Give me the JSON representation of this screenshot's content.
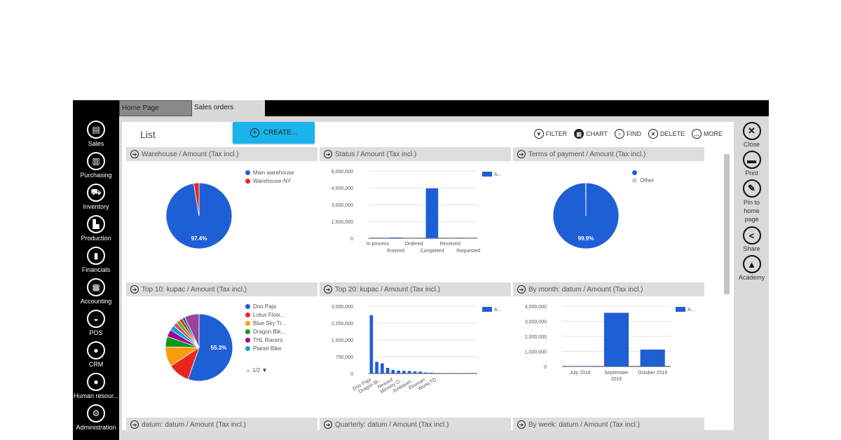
{
  "tabs": [
    {
      "label": "Home Page"
    },
    {
      "label": "Sales orders"
    }
  ],
  "sidebar": {
    "items": [
      {
        "label": "Sales",
        "icon": "sales-icon",
        "glyph": "▤"
      },
      {
        "label": "Purchasing",
        "icon": "purchasing-icon",
        "glyph": "▥"
      },
      {
        "label": "Inventory",
        "icon": "inventory-icon",
        "glyph": "⛟"
      },
      {
        "label": "Production",
        "icon": "production-icon",
        "glyph": "▙"
      },
      {
        "label": "Financials",
        "icon": "financials-icon",
        "glyph": "▮"
      },
      {
        "label": "Accounting",
        "icon": "accounting-icon",
        "glyph": "▦"
      },
      {
        "label": "POS",
        "icon": "pos-icon",
        "glyph": "◒"
      },
      {
        "label": "CRM",
        "icon": "crm-icon",
        "glyph": "●"
      },
      {
        "label": "Human resour...",
        "icon": "human-resources-icon",
        "glyph": "●"
      },
      {
        "label": "Administration",
        "icon": "gear-icon",
        "glyph": "⚙"
      }
    ]
  },
  "main": {
    "title": "List",
    "create_label": "CREATE...",
    "actions": [
      {
        "label": "FILTER",
        "glyph": "▼"
      },
      {
        "label": "CHART",
        "glyph": "▥"
      },
      {
        "label": "FIND",
        "glyph": "○"
      },
      {
        "label": "DELETE",
        "glyph": "✕"
      },
      {
        "label": "MORE",
        "glyph": "…"
      }
    ]
  },
  "rightbar": {
    "items": [
      {
        "label": "Close",
        "glyph": "✕"
      },
      {
        "label": "Print",
        "glyph": "▬"
      },
      {
        "label": "Pin to home page",
        "glyph": "✎"
      },
      {
        "label": "Share",
        "glyph": "<"
      },
      {
        "label": "Academy",
        "glyph": "▲"
      }
    ]
  },
  "colors": {
    "accent": "#1ab4ec",
    "bar": "#1f5fd6"
  },
  "panels": [
    {
      "title": "Warehouse / Amount (Tax incl.)"
    },
    {
      "title": "Status / Amount (Tax incl.)"
    },
    {
      "title": "Terms of payment / Amount (Tax incl.)"
    },
    {
      "title": "Top 10: kupac / Amount (Tax incl.)"
    },
    {
      "title": "Top 20: kupac / Amount (Tax incl.)"
    },
    {
      "title": "By month: datum / Amount (Tax incl.)"
    },
    {
      "title": "datum: datum / Amount (Tax incl.)"
    },
    {
      "title": "Quarterly: datum / Amount (Tax incl.)"
    },
    {
      "title": "By week: datum / Amount (Tax incl.)"
    }
  ],
  "chart_data": [
    {
      "type": "pie",
      "title": "Warehouse / Amount (Tax incl.)",
      "labels": [
        "Main warehouse",
        "Warehouse-NY"
      ],
      "values": [
        97.4,
        2.6
      ],
      "colors": [
        "#1f5fd6",
        "#e8261b"
      ],
      "slice_label": "97.4%"
    },
    {
      "type": "bar",
      "title": "Status / Amount (Tax incl.)",
      "categories": [
        "In process",
        "Entered",
        "Ordered",
        "Completed",
        "Received",
        "Requested"
      ],
      "values": [
        40000,
        60000,
        0,
        4450000,
        0,
        0
      ],
      "ylim": [
        0,
        6000000
      ],
      "yticks": [
        "0",
        "1,500,000",
        "3,000,000",
        "4,500,000",
        "6,000,000"
      ],
      "legend": "A..."
    },
    {
      "type": "pie",
      "title": "Terms of payment / Amount (Tax incl.)",
      "labels": [
        "",
        "Other"
      ],
      "values": [
        99.9,
        0.1
      ],
      "colors": [
        "#1f5fd6",
        "#cccccc"
      ],
      "slice_label": "99.9%"
    },
    {
      "type": "pie",
      "title": "Top 10: kupac / Amount (Tax incl.)",
      "labels": [
        "Doo Paja",
        "Lotus Flow...",
        "Blue Sky Tr...",
        "Dragon Bik...",
        "THL Racers",
        "Planet Bike"
      ],
      "values": [
        55.3,
        10.5,
        9.5,
        5,
        3.5,
        2.5,
        2,
        1.8,
        1.5,
        1.4,
        7
      ],
      "colors": [
        "#1f5fd6",
        "#e8261b",
        "#fb9c0c",
        "#109618",
        "#990099",
        "#0ea2d6",
        "#dd4477",
        "#66aa00",
        "#b82e2e",
        "#316395",
        "#994499"
      ],
      "slice_label": "55.3%",
      "pager": "1/2"
    },
    {
      "type": "bar",
      "title": "Top 20: kupac / Amount (Tax incl.)",
      "categories": [
        "Doo Paja",
        "",
        "Dragon Bi...",
        "",
        "Newauf",
        "",
        "Ministry O...",
        "",
        "Jon&quot...",
        "",
        "Eksmarr",
        "",
        "WorkLTD",
        "",
        "",
        "",
        "",
        "",
        "",
        ""
      ],
      "values": [
        2600000,
        520000,
        450000,
        250000,
        160000,
        130000,
        120000,
        110000,
        90000,
        80000,
        40000,
        30000,
        15000,
        12000,
        10000,
        8000,
        6000,
        5000,
        4000,
        3000
      ],
      "ylim": [
        0,
        3000000
      ],
      "yticks": [
        "0",
        "750,000",
        "1,500,000",
        "2,250,000",
        "3,000,000"
      ],
      "legend": "A..."
    },
    {
      "type": "bar",
      "title": "By month: datum / Amount (Tax incl.)",
      "categories": [
        "July 2016",
        "September 2016",
        "October 2016"
      ],
      "values": [
        0,
        3560000,
        1120000
      ],
      "ylim": [
        0,
        4000000
      ],
      "yticks": [
        "0",
        "1,000,000",
        "2,000,000",
        "3,000,000",
        "4,000,000"
      ],
      "legend": "A..."
    }
  ]
}
